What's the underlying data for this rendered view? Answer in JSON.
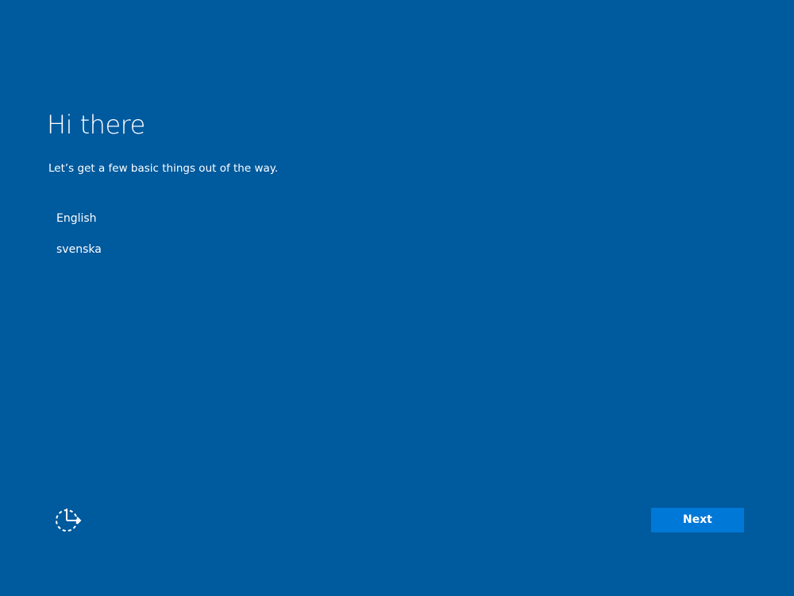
{
  "header": {
    "title": "Hi there",
    "subtitle": "Let’s get a few basic things out of the way."
  },
  "languages": [
    {
      "label": "English"
    },
    {
      "label": "svenska"
    }
  ],
  "footer": {
    "ease_of_access_icon": "ease-of-access-icon",
    "next_label": "Next"
  },
  "colors": {
    "background": "#005a9e",
    "button": "#0078d7",
    "text": "#ffffff"
  }
}
